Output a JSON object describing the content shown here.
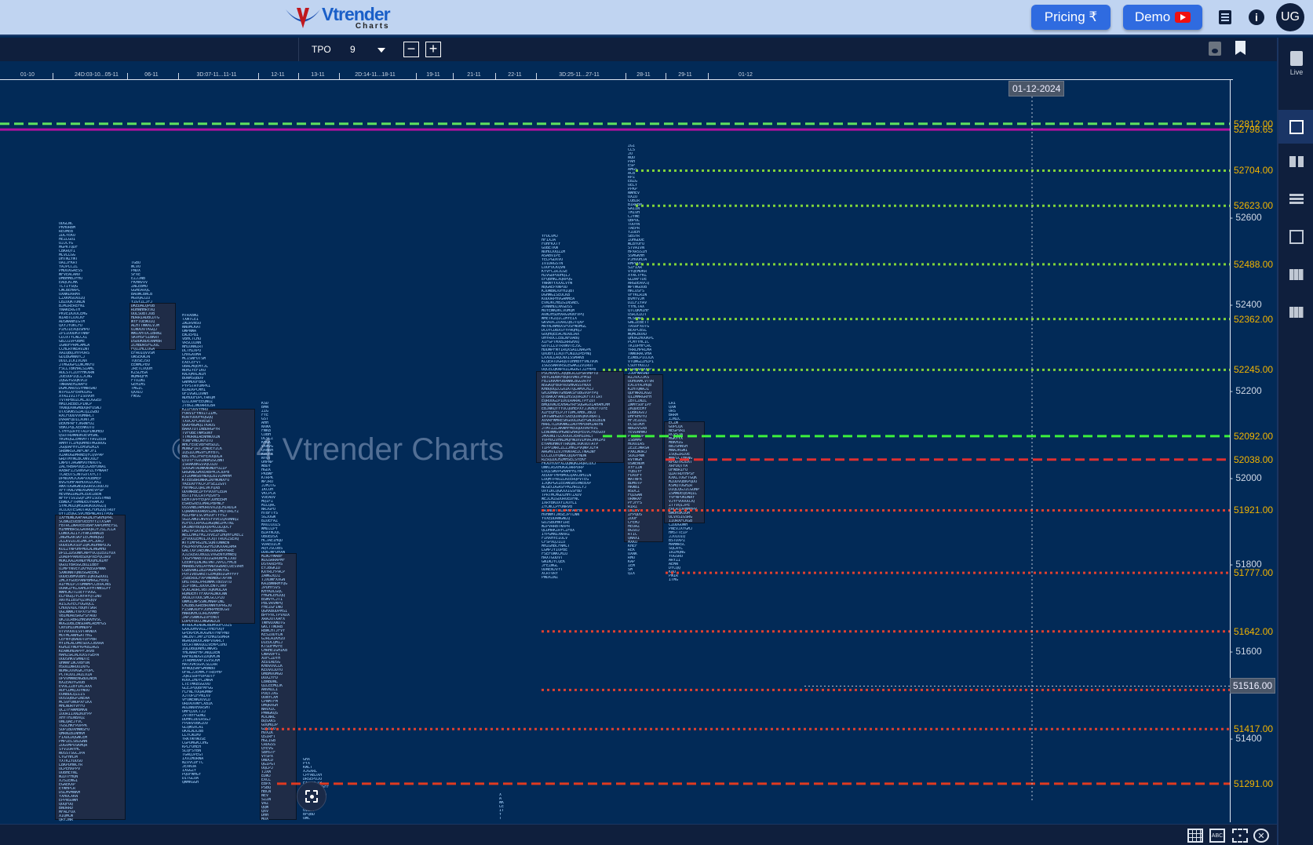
{
  "header": {
    "logo_text": "Vtrender",
    "logo_sub": "Charts",
    "pricing_label": "Pricing ₹",
    "demo_label": "Demo",
    "avatar": "UG"
  },
  "toolbar": {
    "mode": "TPO",
    "value": "9"
  },
  "dates": [
    "01-10",
    "24D:03-10...05-11",
    "06-11",
    "3D:07-11...11-11",
    "12-11",
    "13-11",
    "2D:14-11...18-11",
    "19-11",
    "21-11",
    "22-11",
    "3D:25-11...27-11",
    "28-11",
    "29-11",
    "01-12"
  ],
  "price_ticks": [
    "52600",
    "52400",
    "52200",
    "52000",
    "51800",
    "51600",
    "51400"
  ],
  "levels": [
    {
      "price": 52812.0,
      "label": "52812.00",
      "color": "#5ee05e",
      "style": "dashed"
    },
    {
      "price": 52798.65,
      "label": "52798.65",
      "color": "#b0109f",
      "style": "solid"
    },
    {
      "price": 52704.0,
      "label": "52704.00",
      "color": "#7fd43a",
      "style": "dotted"
    },
    {
      "price": 52623.0,
      "label": "52623.00",
      "color": "#7fd43a",
      "style": "dotted"
    },
    {
      "price": 52488.0,
      "label": "52488.00",
      "color": "#7fd43a",
      "style": "dotted"
    },
    {
      "price": 52362.0,
      "label": "52362.00",
      "color": "#7fd43a",
      "style": "dotted"
    },
    {
      "price": 52245.0,
      "label": "52245.00",
      "color": "#7fd43a",
      "style": "dotted"
    },
    {
      "price": 52092.0,
      "label": "52092.00",
      "color": "#3cf03c",
      "style": "dashed"
    },
    {
      "price": 52038.0,
      "label": "52038.00",
      "color": "#e03030",
      "style": "dashed"
    },
    {
      "price": 51921.0,
      "label": "51921.00",
      "color": "#e04030",
      "style": "dotted"
    },
    {
      "price": 51777.0,
      "label": "51777.00",
      "color": "#e04030",
      "style": "dotted"
    },
    {
      "price": 51642.0,
      "label": "51642.00",
      "color": "#e04030",
      "style": "dotted"
    },
    {
      "price": 51507.0,
      "label": "51507.00",
      "color": "#e04030",
      "style": "dotted"
    },
    {
      "price": 51417.0,
      "label": "51417.00",
      "color": "#e04030",
      "style": "dotted"
    },
    {
      "price": 51291.0,
      "label": "51291.00",
      "color": "#e03a20",
      "style": "dashed"
    }
  ],
  "crosshair": {
    "date": "01-12-2024",
    "price": "51516.00"
  },
  "watermark": "© 2024 Vtrender Charts",
  "sidebar": {
    "live_label": "Live",
    "icons": [
      "single-profile-icon",
      "split-profile-icon",
      "lines-icon",
      "grid-icon",
      "columns-icon",
      "table-icon"
    ]
  },
  "footer": {
    "icons": [
      "grid-icon",
      "abc-icon",
      "focus-icon",
      "close-circle-icon"
    ],
    "abc_text": "ABC"
  }
}
